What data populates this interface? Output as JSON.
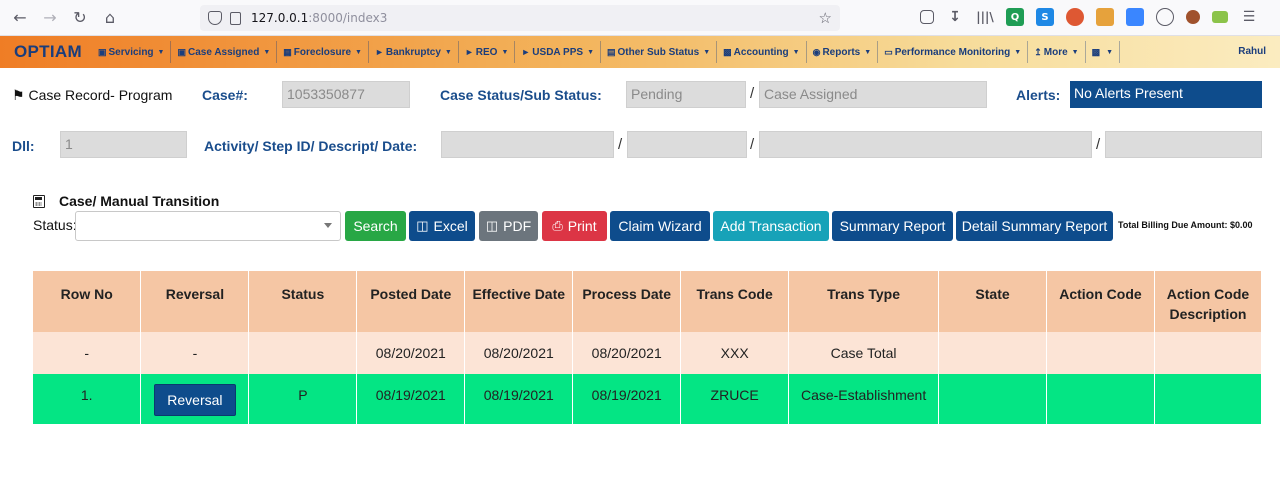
{
  "browser": {
    "url_host": "127.0.0.1",
    "url_path": ":8000/index3"
  },
  "navbar": {
    "brand": "OPTIAM",
    "items": [
      {
        "label": "Servicing"
      },
      {
        "label": "Case Assigned"
      },
      {
        "label": "Foreclosure"
      },
      {
        "label": "Bankruptcy"
      },
      {
        "label": "REO"
      },
      {
        "label": "USDA PPS"
      },
      {
        "label": "Other Sub Status"
      },
      {
        "label": "Accounting"
      },
      {
        "label": "Reports"
      },
      {
        "label": "Performance Monitoring"
      },
      {
        "label": "More"
      },
      {
        "label": ""
      }
    ],
    "user": "Rahul"
  },
  "case_info": {
    "record_label": "Case Record- Program",
    "case_no_label": "Case#:",
    "case_no_value": "1053350877",
    "status_label": "Case Status/Sub Status:",
    "status_value": "Pending",
    "sub_status_value": "Case Assigned",
    "alerts_label": "Alerts:",
    "alerts_value": "No Alerts Present",
    "dll_label": "Dll:",
    "dll_value": "1",
    "activity_label": "Activity/ Step ID/ Descript/ Date:"
  },
  "transition": {
    "title": "Case/ Manual Transition",
    "status_label": "Status:",
    "buttons": {
      "search": "Search",
      "excel": "Excel",
      "pdf": "PDF",
      "print": "Print",
      "claim_wizard": "Claim Wizard",
      "add_transaction": "Add Transaction",
      "summary_report": "Summary Report",
      "detail_summary_report": "Detail Summary Report"
    },
    "billing": "Total Billing Due Amount: $0.00"
  },
  "table": {
    "headers": [
      "Row No",
      "Reversal",
      "Status",
      "Posted Date",
      "Effective Date",
      "Process Date",
      "Trans Code",
      "Trans Type",
      "State",
      "Action Code",
      "Action Code Description"
    ],
    "total_row": [
      "-",
      "-",
      "",
      "08/20/2021",
      "08/20/2021",
      "08/20/2021",
      "XXX",
      "Case Total",
      "",
      "",
      ""
    ],
    "data_row": {
      "row_no": "1.",
      "reversal_label": "Reversal",
      "status": "P",
      "posted": "08/19/2021",
      "effective": "08/19/2021",
      "process": "08/19/2021",
      "trans_code": "ZRUCE",
      "trans_type": "Case-Establishment",
      "state": "",
      "action_code": "",
      "action_desc": ""
    }
  },
  "colors": {
    "brand_blue": "#1a3d7c",
    "search_green": "#28a745",
    "excel_blue": "#0e4c8c",
    "pdf_gray": "#6c757d",
    "print_red": "#dc3545",
    "add_teal": "#17a2b8",
    "row_green": "#04e584",
    "header_peach": "#f5c6a4",
    "total_peach": "#fce4d6"
  }
}
